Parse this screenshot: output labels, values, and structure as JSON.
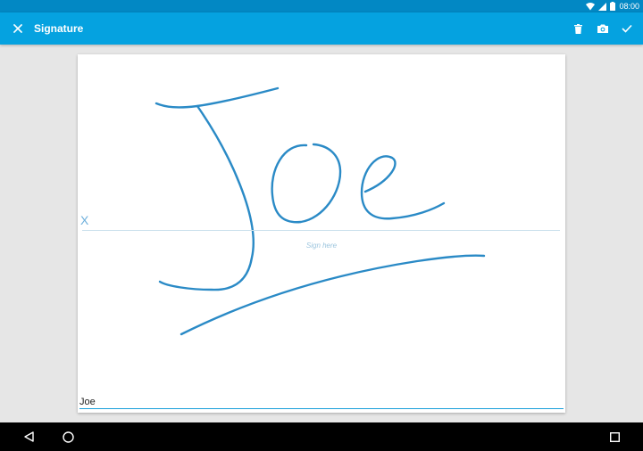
{
  "status_bar": {
    "time": "08:00",
    "icons": [
      "wifi-icon",
      "signal-icon",
      "battery-icon"
    ]
  },
  "toolbar": {
    "title": "Signature",
    "icons": [
      "close-icon",
      "delete-icon",
      "camera-icon",
      "check-icon"
    ]
  },
  "signature_pad": {
    "sign_mark": "X",
    "hint": "Sign here",
    "name_value": "Joe",
    "stroke_color": "#2a8ac6"
  },
  "navigation_bar": {
    "icons": [
      "back-icon",
      "home-icon",
      "recents-icon"
    ]
  },
  "colors": {
    "status_bar": "#0288c4",
    "toolbar": "#05a2e0",
    "background": "#e6e6e6",
    "accent": "#1aa0da"
  }
}
